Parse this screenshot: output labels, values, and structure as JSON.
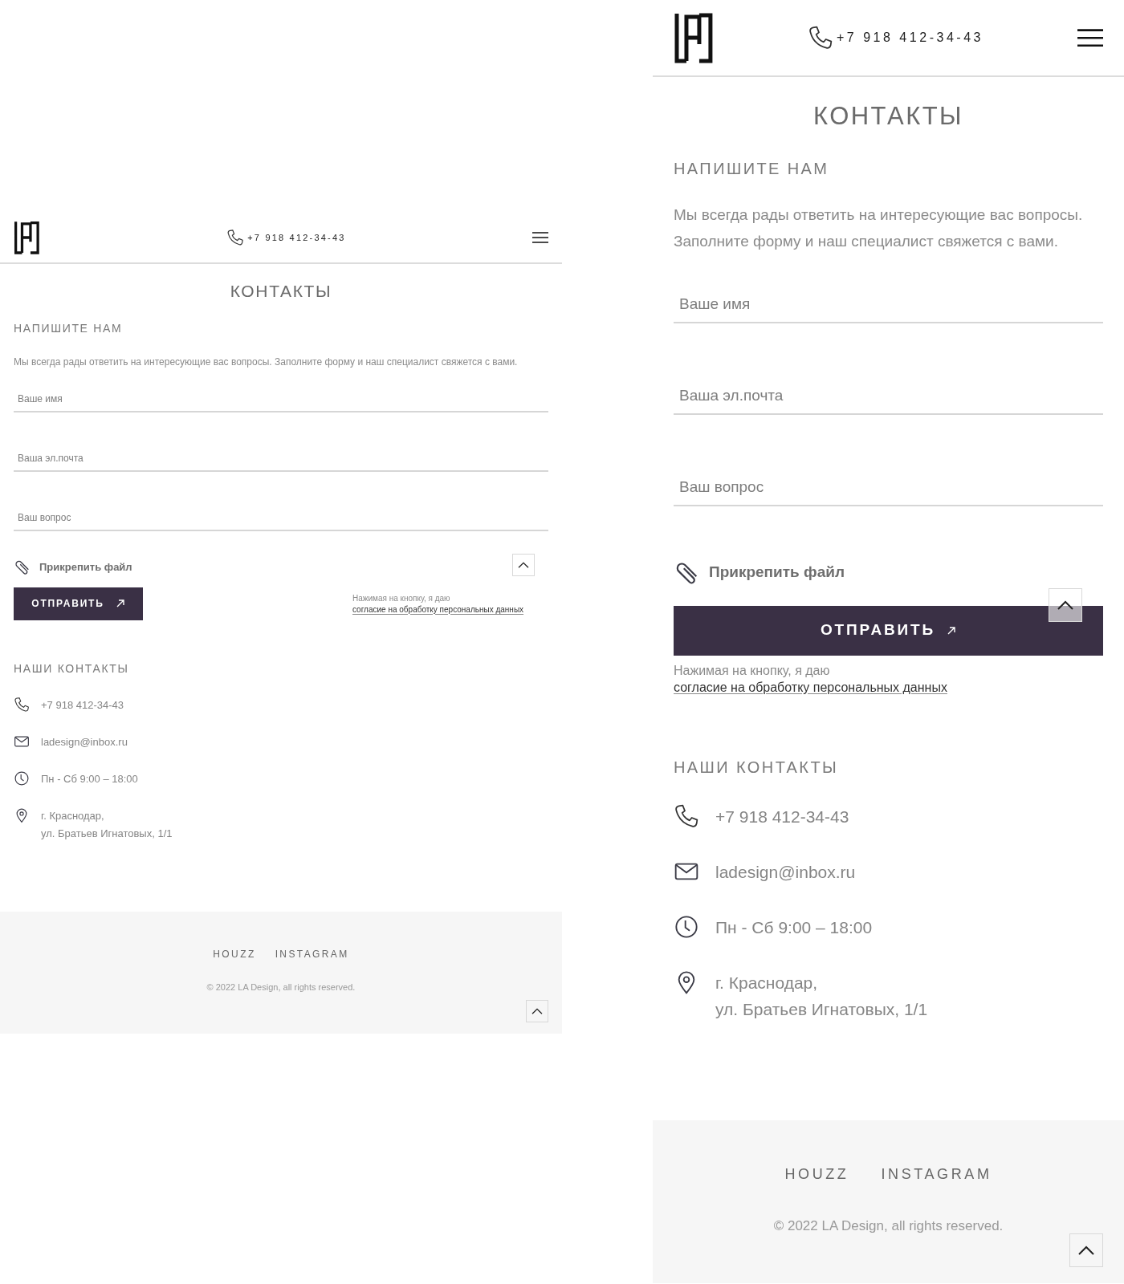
{
  "views": [
    {
      "kind": "wide",
      "header": {
        "phone": "+7 918 412-34-43"
      },
      "title": "КОНТАКТЫ",
      "form": {
        "heading": "НАПИШИТЕ НАМ",
        "intro": "Мы всегда рады ответить на интересующие вас вопросы. Заполните форму и наш специалист свяжется с вами.",
        "fields": [
          {
            "placeholder": "Ваше имя"
          },
          {
            "placeholder": "Ваша эл.почта"
          },
          {
            "placeholder": "Ваш вопрос"
          }
        ],
        "attach": "Прикрепить файл",
        "submit": "ОТПРАВИТЬ",
        "consent": "Нажимая на кнопку, я даю",
        "consent_link": "согласие на обработку персональных данных"
      },
      "contacts": {
        "heading": "НАШИ КОНТАКТЫ",
        "items": [
          {
            "kind": "phone",
            "lines": [
              "+7 918 412-34-43"
            ]
          },
          {
            "kind": "email",
            "lines": [
              "ladesign@inbox.ru"
            ]
          },
          {
            "kind": "hours",
            "lines": [
              "Пн - Сб 9:00 – 18:00"
            ]
          },
          {
            "kind": "address",
            "lines": [
              "г. Краснодар,",
              "ул. Братьев Игнатовых, 1/1"
            ]
          }
        ]
      },
      "footer": {
        "links": [
          "HOUZZ",
          "INSTAGRAM"
        ],
        "copyright": "© 2022 LA Design, all rights reserved."
      }
    },
    {
      "kind": "narrow",
      "header": {
        "phone": "+7 918 412-34-43"
      },
      "title": "КОНТАКТЫ",
      "form": {
        "heading": "НАПИШИТЕ НАМ",
        "intro": "Мы всегда рады ответить на интересующие вас вопросы. Заполните форму и наш специалист свяжется с вами.",
        "fields": [
          {
            "placeholder": "Ваше имя"
          },
          {
            "placeholder": "Ваша эл.почта"
          },
          {
            "placeholder": "Ваш вопрос"
          }
        ],
        "attach": "Прикрепить файл",
        "submit": "ОТПРАВИТЬ",
        "consent": "Нажимая на кнопку, я даю",
        "consent_link": "согласие на обработку персональных данных"
      },
      "contacts": {
        "heading": "НАШИ КОНТАКТЫ",
        "items": [
          {
            "kind": "phone",
            "lines": [
              "+7 918 412-34-43"
            ]
          },
          {
            "kind": "email",
            "lines": [
              "ladesign@inbox.ru"
            ]
          },
          {
            "kind": "hours",
            "lines": [
              "Пн - Сб 9:00 – 18:00"
            ]
          },
          {
            "kind": "address",
            "lines": [
              "г. Краснодар,",
              "ул. Братьев Игнатовых, 1/1"
            ]
          }
        ]
      },
      "footer": {
        "links": [
          "HOUZZ",
          "INSTAGRAM"
        ],
        "copyright": "© 2022 LA Design, all rights reserved."
      }
    }
  ]
}
